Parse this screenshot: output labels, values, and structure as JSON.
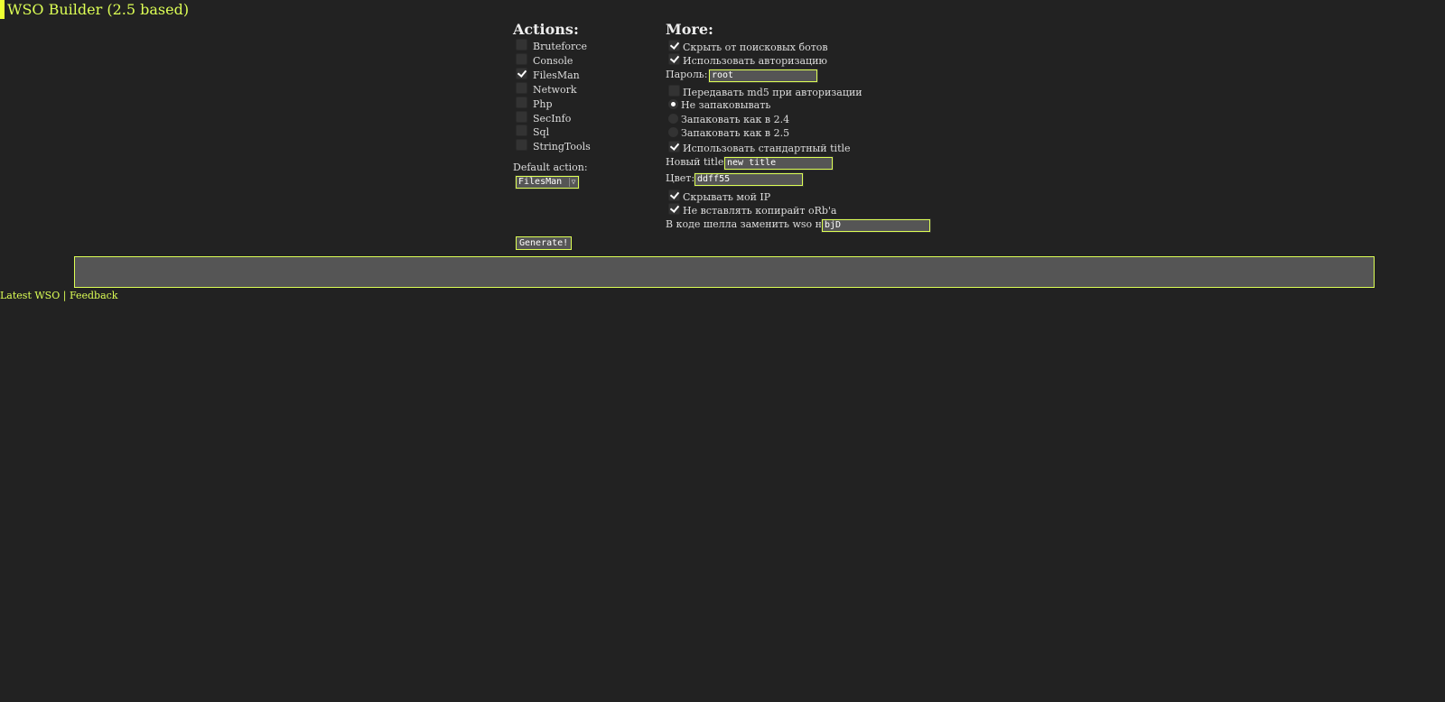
{
  "title": "WSO Builder (2.5 based)",
  "actions": {
    "heading": "Actions:",
    "items": [
      {
        "label": "Bruteforce",
        "checked": false
      },
      {
        "label": "Console",
        "checked": false
      },
      {
        "label": "FilesMan",
        "checked": true
      },
      {
        "label": "Network",
        "checked": false
      },
      {
        "label": "Php",
        "checked": false
      },
      {
        "label": "SecInfo",
        "checked": false
      },
      {
        "label": "Sql",
        "checked": false
      },
      {
        "label": "StringTools",
        "checked": false
      }
    ],
    "default_label": "Default action:",
    "default_value": "FilesMan",
    "generate_label": "Generate!"
  },
  "more": {
    "heading": "More:",
    "hide_bots": {
      "label": "Скрыть от поисковых ботов",
      "checked": true
    },
    "use_auth": {
      "label": "Использовать авторизацию",
      "checked": true
    },
    "password_label": "Пароль:",
    "password_value": "root",
    "md5": {
      "label": "Передавать md5 при авторизации",
      "checked": false
    },
    "pack_options": [
      {
        "label": "Не запаковывать",
        "checked": true
      },
      {
        "label": "Запаковать как в 2.4",
        "checked": false
      },
      {
        "label": "Запаковать как в 2.5",
        "checked": false
      }
    ],
    "std_title": {
      "label": "Использовать стандартный title",
      "checked": true
    },
    "new_title_label": "Новый title:",
    "new_title_value": "new title",
    "color_label": "Цвет:",
    "color_value": "ddff55",
    "hide_ip": {
      "label": "Скрывать мой IP",
      "checked": true
    },
    "no_copyright": {
      "label": "Не вставлять копирайт oRb'a",
      "checked": true
    },
    "replace_label": "В коде шелла заменить wso на:",
    "replace_value": "bjD"
  },
  "output_text": "",
  "footer": {
    "latest_link": "Latest WSO",
    "separator": "|",
    "feedback_link": "Feedback"
  },
  "colors": {
    "background": "#222222",
    "accent": "#ddff55",
    "input_bg": "#555555"
  }
}
